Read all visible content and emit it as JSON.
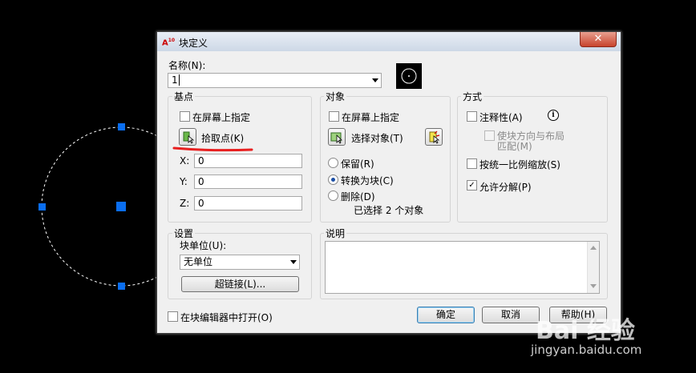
{
  "colors": {
    "dialog_bg": "#f0f0f0",
    "grip_blue": "#0a6ef0",
    "annotation_red": "#e81f1f",
    "canvas_bg": "#000000"
  },
  "dialog": {
    "title": "块定义",
    "app_icon": "A",
    "app_icon_sub": "10",
    "close": "✕",
    "name_label": "名称(N):",
    "name_value": "1"
  },
  "base_point": {
    "title": "基点",
    "specify_on_screen": "在屏幕上指定",
    "pick_point": "拾取点(K)",
    "x_label": "X:",
    "x_value": "0",
    "y_label": "Y:",
    "y_value": "0",
    "z_label": "Z:",
    "z_value": "0"
  },
  "objects": {
    "title": "对象",
    "specify_on_screen": "在屏幕上指定",
    "select_objects": "选择对象(T)",
    "retain": "保留(R)",
    "convert_to_block": "转换为块(C)",
    "delete": "删除(D)",
    "selected_count": "已选择 2 个对象"
  },
  "behavior": {
    "title": "方式",
    "annotative": "注释性(A)",
    "info_icon": "i",
    "match_orientation_line1": "使块方向与布局",
    "match_orientation_line2": "匹配(M)",
    "scale_uniformly": "按统一比例缩放(S)",
    "allow_exploding": "允许分解(P)",
    "allow_exploding_checked": "✓"
  },
  "settings": {
    "title": "设置",
    "block_unit_label": "块单位(U):",
    "block_unit_value": "无单位",
    "hyperlink": "超链接(L)..."
  },
  "description": {
    "title": "说明",
    "value": ""
  },
  "footer": {
    "open_in_editor": "在块编辑器中打开(O)",
    "ok": "确定",
    "cancel": "取消",
    "help": "帮助(H)"
  },
  "watermark": {
    "brand": "Bai 经验",
    "url": "jingyan.baidu.com"
  }
}
